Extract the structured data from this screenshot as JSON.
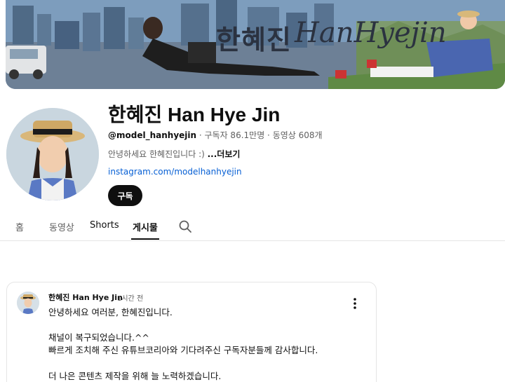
{
  "banner": {
    "title_ko": "한혜진",
    "title_en": "HanHyejin"
  },
  "channel": {
    "name": "한혜진 Han Hye Jin",
    "handle": "@model_hanhyejin",
    "subscribers": "구독자 86.1만명",
    "videos": "동영상 608개",
    "separator": " · ",
    "description": "안녕하세요 한혜진입니다 :) ",
    "more_label": "...더보기",
    "link": "instagram.com/modelhanhyejin",
    "subscribe_label": "구독"
  },
  "tabs": [
    {
      "label": "홈",
      "active": false
    },
    {
      "label": "동영상",
      "active": false
    },
    {
      "label": "Shorts",
      "active": false
    },
    {
      "label": "게시물",
      "active": true
    }
  ],
  "post": {
    "author": "한혜진 Han Hye Jin",
    "time": "1시간 전",
    "lines": [
      "안녕하세요 여러분, 한혜진입니다.",
      "채널이 복구되었습니다.^^",
      "빠르게 조치해 주신 유튜브코리아와 기다려주신 구독자분들께 감사합니다.",
      "더 나은 콘텐츠 제작을 위해 늘 노력하겠습니다."
    ]
  },
  "colors": {
    "link": "#065fd4",
    "subscribe_bg": "#0f0f0f",
    "muted_text": "#606060"
  }
}
